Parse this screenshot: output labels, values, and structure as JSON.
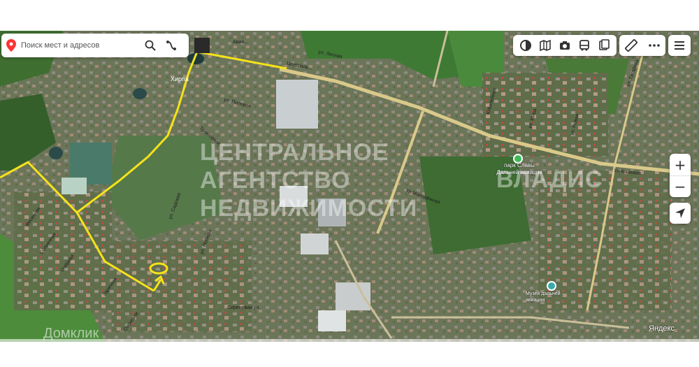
{
  "search": {
    "placeholder": "Поиск мест и адресов"
  },
  "icons": {
    "pin": "map-pin-icon",
    "search": "search-icon",
    "route": "route-icon",
    "layers": "layers-icon",
    "panorama": "panorama-icon",
    "camera": "camera-icon",
    "transit": "bus-icon",
    "traffic": "traffic-icon",
    "ruler": "ruler-icon",
    "more": "more-icon",
    "menu": "menu-icon",
    "locate": "locate-icon"
  },
  "zoom": {
    "in_label": "+",
    "out_label": "−"
  },
  "places": {
    "village": "Хирпа",
    "park": "парк Славы",
    "park_sub": "Дальней авиации",
    "museum": "Музей дальней авиации"
  },
  "streets": [
    {
      "label": "Авиа..."
    },
    {
      "label": "Централь..."
    },
    {
      "label": "Ул Кошевая"
    },
    {
      "label": "ул. Лесная"
    },
    {
      "label": "ул. Полевая"
    },
    {
      "label": "Тракторная"
    },
    {
      "label": "ул. Садовая"
    },
    {
      "label": "Сиреневая ул."
    },
    {
      "label": "Юбилейная"
    },
    {
      "label": "ул. Мира"
    },
    {
      "label": "ул. Новая"
    },
    {
      "label": "Весенняя"
    },
    {
      "label": "Солнечная"
    },
    {
      "label": "Озёрная"
    },
    {
      "label": "Сосновая"
    },
    {
      "label": "Заречная"
    },
    {
      "label": "Ул Молодёжная"
    },
    {
      "label": "ул. Победы"
    },
    {
      "label": "ул. Гагарина"
    }
  ],
  "watermarks": {
    "agency_line1": "ЦЕНТРАЛЬНОЕ",
    "agency_line2": "АГЕНТСТВО",
    "agency_line3": "НЕДВИЖИМОСТИ",
    "vladis": "ВЛАДИС",
    "domklik": "Домклик"
  },
  "branding": {
    "yandex": "Яндекс"
  },
  "colors": {
    "route": "#f5e31a",
    "satellite_base": "#6a7a52",
    "field_green": "#4f8a3a",
    "road": "#d9c98a"
  }
}
